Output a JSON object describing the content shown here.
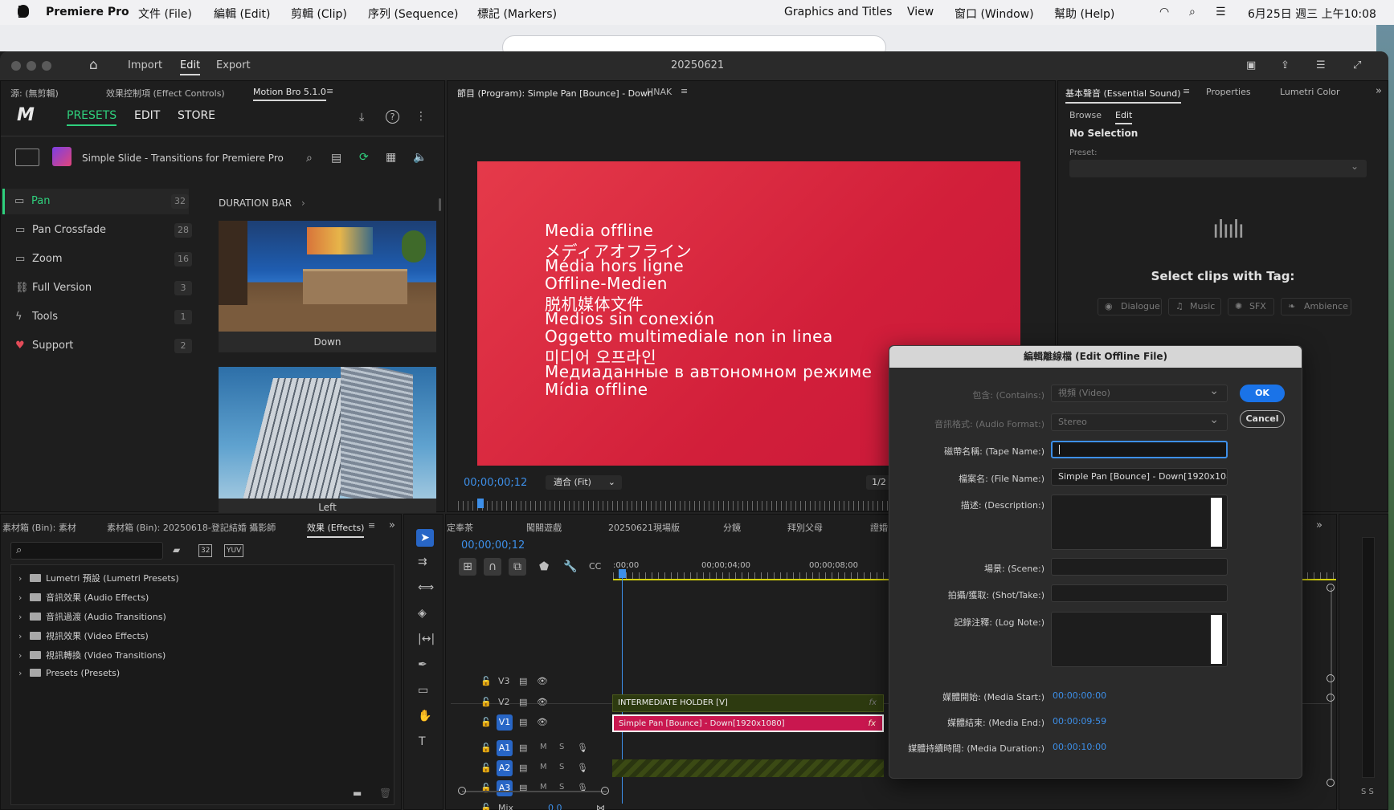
{
  "menubar": {
    "apple": "",
    "app": "Premiere Pro",
    "items": [
      "文件 (File)",
      "編輯 (Edit)",
      "剪輯 (Clip)",
      "序列 (Sequence)",
      "標記 (Markers)",
      "Graphics and Titles",
      "View",
      "窗口 (Window)",
      "幫助 (Help)"
    ],
    "datetime": "6月25日 週三 上午10:08"
  },
  "titlebar": {
    "nav": [
      "Import",
      "Edit",
      "Export"
    ],
    "project": "20250621"
  },
  "source_panel": {
    "tabs": [
      "源: (無剪輯)",
      "效果控制項 (Effect Controls)",
      "Motion Bro 5.1.0"
    ]
  },
  "motion_bro": {
    "tabs": [
      "PRESETS",
      "EDIT",
      "STORE"
    ],
    "pack_name": "Simple Slide - Transitions for Premiere Pro",
    "categories": [
      {
        "label": "Pan",
        "count": "32"
      },
      {
        "label": "Pan Crossfade",
        "count": "28"
      },
      {
        "label": "Zoom",
        "count": "16"
      },
      {
        "label": "Full Version",
        "count": "3"
      },
      {
        "label": "Tools",
        "count": "1"
      },
      {
        "label": "Support",
        "count": "2"
      }
    ],
    "section": "DURATION BAR",
    "thumbs": [
      "Down",
      "Left"
    ]
  },
  "program": {
    "title": "節目 (Program): Simple Pan [Bounce] - Down",
    "extra_tab": "HNAK",
    "offline_lines": [
      "Media offline",
      "メディアオフライン",
      "Média hors ligne",
      "Offline-Medien",
      "脱机媒体文件",
      "Medios sin conexión",
      "Oggetto multimediale non in linea",
      "미디어 오프라인",
      "Медиаданные в автономном режиме",
      "Mídia offline"
    ],
    "timecode": "00;00;00;12",
    "fit": "適合 (Fit)",
    "resolution": "1/2"
  },
  "essential_sound": {
    "tabs": [
      "基本聲音 (Essential Sound)",
      "Properties",
      "Lumetri Color"
    ],
    "subtabs": [
      "Browse",
      "Edit"
    ],
    "no_selection": "No Selection",
    "preset_label": "Preset:",
    "select_clips": "Select clips with Tag:",
    "tags": [
      "Dialogue",
      "Music",
      "SFX",
      "Ambience"
    ]
  },
  "effects_panel": {
    "tabs": [
      "素材箱 (Bin): 素材",
      "素材箱 (Bin): 20250618-登記結婚 攝影師",
      "效果 (Effects)"
    ],
    "tree": [
      "Lumetri 預設 (Lumetri Presets)",
      "音訊效果 (Audio Effects)",
      "音訊過渡 (Audio Transitions)",
      "視訊效果 (Video Effects)",
      "視訊轉換 (Video Transitions)",
      "Presets (Presets)"
    ]
  },
  "timeline": {
    "tabs": [
      "定奉茶",
      "闖關遊戲",
      "20250621現場版",
      "分鏡",
      "拜別父母",
      "證婚"
    ],
    "timecode": "00;00;00;12",
    "ruler": [
      ":00;00",
      "00;00;04;00",
      "00;00;08;00"
    ],
    "video_tracks": [
      "V3",
      "V2",
      "V1"
    ],
    "audio_tracks": [
      "A1",
      "A2",
      "A3"
    ],
    "mix_label": "Mix",
    "mix_value": "0.0",
    "m_label": "M",
    "s_label": "S",
    "clip_v2": "INTERMEDIATE HOLDER [V]",
    "clip_v1": "Simple Pan [Bounce] - Down[1920x1080]",
    "fx": "fx"
  },
  "dialog": {
    "title": "編輯離線檔 (Edit Offline File)",
    "contains_label": "包含: (Contains:)",
    "contains_value": "視頻 (Video)",
    "audio_format_label": "音訊格式: (Audio Format:)",
    "audio_format_value": "Stereo",
    "tape_name_label": "磁帶名稱: (Tape Name:)",
    "tape_name_value": "",
    "file_name_label": "檔案名: (File Name:)",
    "file_name_value": "Simple Pan [Bounce] - Down[1920x1080]",
    "description_label": "描述: (Description:)",
    "scene_label": "場景: (Scene:)",
    "shot_label": "拍攝/獲取: (Shot/Take:)",
    "log_note_label": "記錄注釋: (Log Note:)",
    "media_start_label": "媒體開始: (Media Start:)",
    "media_start_value": "00:00:00:00",
    "media_end_label": "媒體結束: (Media End:)",
    "media_end_value": "00:00:09:59",
    "media_duration_label": "媒體持續時間: (Media Duration:)",
    "media_duration_value": "00:00:10:00",
    "ok": "OK",
    "cancel": "Cancel"
  },
  "meter": {
    "labels": "S S"
  },
  "colors": {
    "accent": "#3d8fe8",
    "mb_green": "#2fd07d",
    "clip_pink": "#c9174f",
    "clip_olive": "#3b4a14",
    "offline_red": "#d72a40"
  }
}
